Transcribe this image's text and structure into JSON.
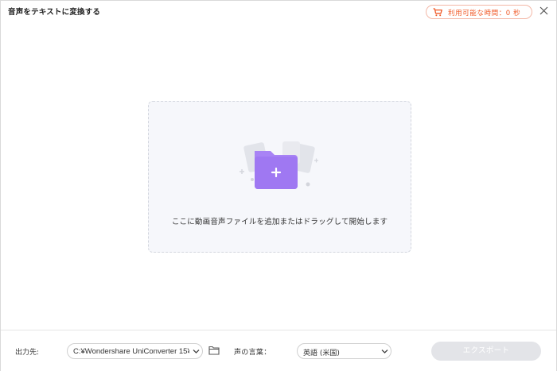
{
  "window": {
    "title": "音声をテキストに変換する",
    "available_time_text": "利用可能な時間：0 秒"
  },
  "dropzone": {
    "prompt": "ここに動画音声ファイルを追加またはドラッグして開始します"
  },
  "bottom": {
    "output_label": "出力先:",
    "output_path": "C:¥Wondershare UniConverter 15¥",
    "language_label": "声の言葉：",
    "language_value": "英語 (米国)",
    "export_label": "エクスポート"
  },
  "colors": {
    "accent_orange": "#f05a28",
    "folder_purple": "#a883f5",
    "export_disabled": "#e3e4e8"
  },
  "icons": [
    "cart-icon",
    "close-icon",
    "folder-add-icon",
    "chevron-down-icon",
    "folder-open-icon"
  ]
}
